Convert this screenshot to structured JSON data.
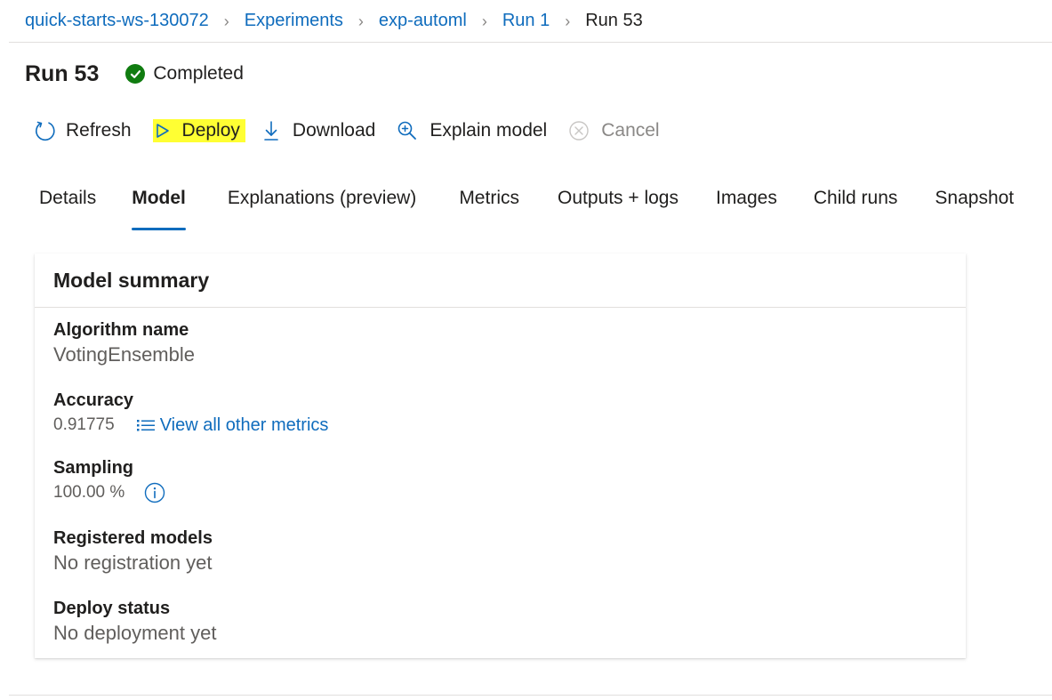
{
  "breadcrumb": {
    "items": [
      {
        "label": "quick-starts-ws-130072"
      },
      {
        "label": "Experiments"
      },
      {
        "label": "exp-automl"
      },
      {
        "label": "Run 1"
      },
      {
        "label": "Run 53"
      }
    ]
  },
  "header": {
    "title": "Run 53",
    "status": "Completed",
    "status_color": "#107c10"
  },
  "toolbar": {
    "refresh": "Refresh",
    "deploy": "Deploy",
    "download": "Download",
    "explain": "Explain model",
    "cancel": "Cancel",
    "highlight_color": "#ffff33"
  },
  "tabs": [
    {
      "label": "Details"
    },
    {
      "label": "Model"
    },
    {
      "label": "Explanations (preview)"
    },
    {
      "label": "Metrics"
    },
    {
      "label": "Outputs + logs"
    },
    {
      "label": "Images"
    },
    {
      "label": "Child runs"
    },
    {
      "label": "Snapshot"
    }
  ],
  "active_tab": "Model",
  "card": {
    "title": "Model summary",
    "fields": {
      "algorithm": {
        "label": "Algorithm name",
        "value": "VotingEnsemble"
      },
      "accuracy": {
        "label": "Accuracy",
        "value": "0.91775",
        "link": "View all other metrics"
      },
      "sampling": {
        "label": "Sampling",
        "value": "100.00 %"
      },
      "registered": {
        "label": "Registered models",
        "value": "No registration yet"
      },
      "deploy": {
        "label": "Deploy status",
        "value": "No deployment yet"
      }
    }
  },
  "colors": {
    "link": "#0f6cbd",
    "accent": "#0f6cbd",
    "text": "#201f1e",
    "secondary_text": "#605e5c",
    "disabled": "#8a8886"
  }
}
